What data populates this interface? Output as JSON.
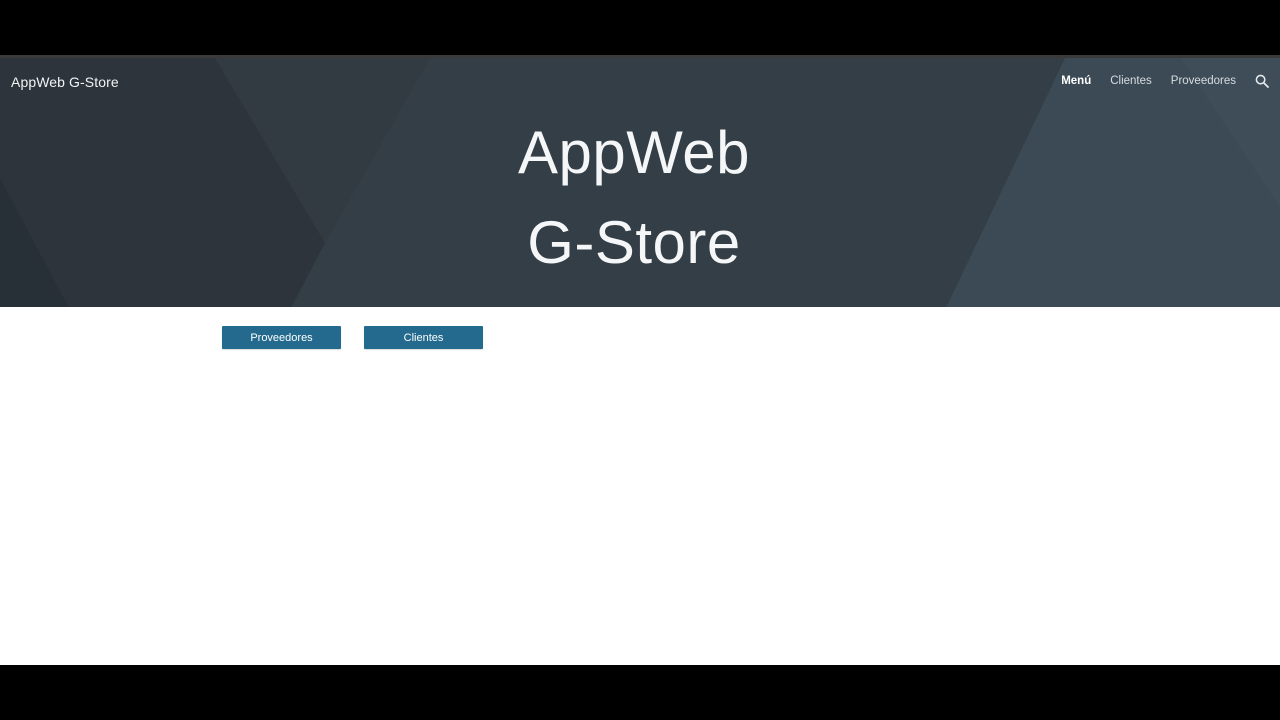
{
  "header": {
    "site_title": "AppWeb G-Store",
    "nav": [
      {
        "label": "Menú",
        "active": true
      },
      {
        "label": "Clientes",
        "active": false
      },
      {
        "label": "Proveedores",
        "active": false
      }
    ],
    "search_icon": "search-icon"
  },
  "hero": {
    "line1": "AppWeb",
    "line2": "G-Store"
  },
  "main": {
    "buttons": [
      {
        "label": "Proveedores"
      },
      {
        "label": "Clientes"
      }
    ]
  },
  "colors": {
    "hero_bg": "#343d45",
    "button": "#236a8e",
    "letterbox": "#000000"
  }
}
